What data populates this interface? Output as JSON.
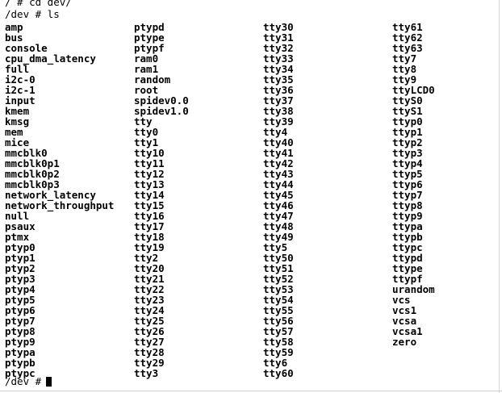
{
  "terminal": {
    "lines": {
      "cd_command": "/ # cd dev/",
      "ls_command": "/dev # ls",
      "final_prompt": "/dev #"
    },
    "listing": {
      "column_1": [
        "amp",
        "bus",
        "console",
        "cpu_dma_latency",
        "full",
        "i2c-0",
        "i2c-1",
        "input",
        "kmem",
        "kmsg",
        "mem",
        "mice",
        "mmcblk0",
        "mmcblk0p1",
        "mmcblk0p2",
        "mmcblk0p3",
        "network_latency",
        "network_throughput",
        "null",
        "psaux",
        "ptmx",
        "ptyp0",
        "ptyp1",
        "ptyp2",
        "ptyp3",
        "ptyp4",
        "ptyp5",
        "ptyp6",
        "ptyp7",
        "ptyp8",
        "ptyp9",
        "ptypa",
        "ptypb",
        "ptypc"
      ],
      "column_2": [
        "ptypd",
        "ptype",
        "ptypf",
        "ram0",
        "ram1",
        "random",
        "root",
        "spidev0.0",
        "spidev1.0",
        "tty",
        "tty0",
        "tty1",
        "tty10",
        "tty11",
        "tty12",
        "tty13",
        "tty14",
        "tty15",
        "tty16",
        "tty17",
        "tty18",
        "tty19",
        "tty2",
        "tty20",
        "tty21",
        "tty22",
        "tty23",
        "tty24",
        "tty25",
        "tty26",
        "tty27",
        "tty28",
        "tty29",
        "tty3"
      ],
      "column_3": [
        "tty30",
        "tty31",
        "tty32",
        "tty33",
        "tty34",
        "tty35",
        "tty36",
        "tty37",
        "tty38",
        "tty39",
        "tty4",
        "tty40",
        "tty41",
        "tty42",
        "tty43",
        "tty44",
        "tty45",
        "tty46",
        "tty47",
        "tty48",
        "tty49",
        "tty5",
        "tty50",
        "tty51",
        "tty52",
        "tty53",
        "tty54",
        "tty55",
        "tty56",
        "tty57",
        "tty58",
        "tty59",
        "tty6",
        "tty60"
      ],
      "column_4": [
        "tty61",
        "tty62",
        "tty63",
        "tty7",
        "tty8",
        "tty9",
        "ttyLCD0",
        "ttyS0",
        "ttyS1",
        "ttyp0",
        "ttyp1",
        "ttyp2",
        "ttyp3",
        "ttyp4",
        "ttyp5",
        "ttyp6",
        "ttyp7",
        "ttyp8",
        "ttyp9",
        "ttypa",
        "ttypb",
        "ttypc",
        "ttypd",
        "ttype",
        "ttypf",
        "urandom",
        "vcs",
        "vcs1",
        "vcsa",
        "vcsa1",
        "zero"
      ]
    },
    "colors": {
      "background": "#ffffff",
      "text": "#000000"
    }
  }
}
